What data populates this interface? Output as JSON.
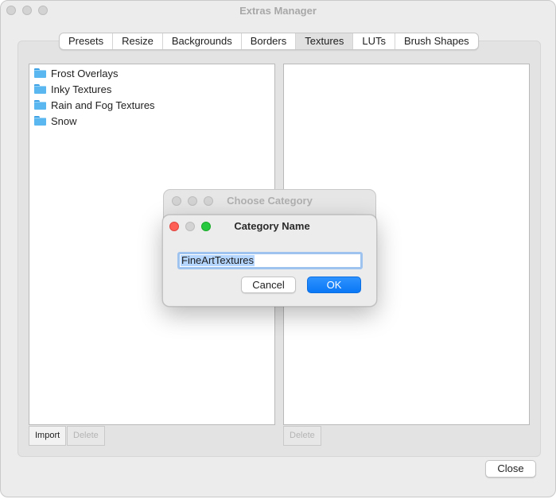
{
  "window": {
    "title": "Extras Manager"
  },
  "tabs": [
    {
      "label": "Presets",
      "selected": false
    },
    {
      "label": "Resize",
      "selected": false
    },
    {
      "label": "Backgrounds",
      "selected": false
    },
    {
      "label": "Borders",
      "selected": false
    },
    {
      "label": "Textures",
      "selected": true
    },
    {
      "label": "LUTs",
      "selected": false
    },
    {
      "label": "Brush Shapes",
      "selected": false
    }
  ],
  "left_pane": {
    "items": [
      {
        "label": "Frost Overlays",
        "icon": "folder-icon"
      },
      {
        "label": "Inky Textures",
        "icon": "folder-icon"
      },
      {
        "label": "Rain and Fog Textures",
        "icon": "folder-icon"
      },
      {
        "label": "Snow",
        "icon": "folder-icon"
      }
    ],
    "import_label": "Import",
    "delete_label": "Delete"
  },
  "right_pane": {
    "delete_label": "Delete"
  },
  "close_label": "Close",
  "choose_category_dialog": {
    "title": "Choose Category"
  },
  "category_name_dialog": {
    "title": "Category Name",
    "field_value": "FineArtTextures",
    "cancel_label": "Cancel",
    "ok_label": "OK"
  },
  "colors": {
    "accent_blue": "#0a77f5",
    "folder_blue": "#5ab7f0",
    "traffic_red": "#fe5f57",
    "traffic_green": "#28c840",
    "selection": "#b4d5fd"
  }
}
